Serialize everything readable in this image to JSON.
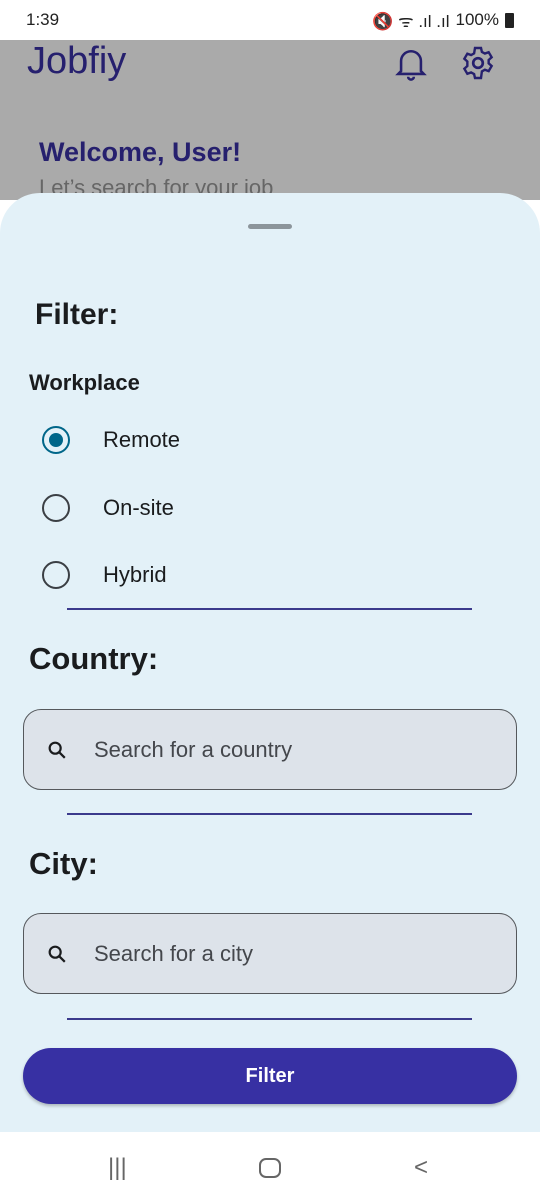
{
  "status_bar": {
    "time": "1:39",
    "battery": "100%"
  },
  "app": {
    "title": "Jobfiy",
    "welcome": "Welcome, User!",
    "subtitle": "Let’s search for your job"
  },
  "filter": {
    "title": "Filter:",
    "workplace_label": "Workplace",
    "workplace_options": [
      {
        "label": "Remote",
        "selected": true
      },
      {
        "label": "On-site",
        "selected": false
      },
      {
        "label": "Hybrid",
        "selected": false
      }
    ],
    "country_label": "Country:",
    "country_placeholder": "Search for a country",
    "city_label": "City:",
    "city_placeholder": "Search for a city",
    "button": "Filter"
  },
  "colors": {
    "primary": "#3730a3",
    "radio": "#006689",
    "sheet": "#e3f1f8"
  }
}
